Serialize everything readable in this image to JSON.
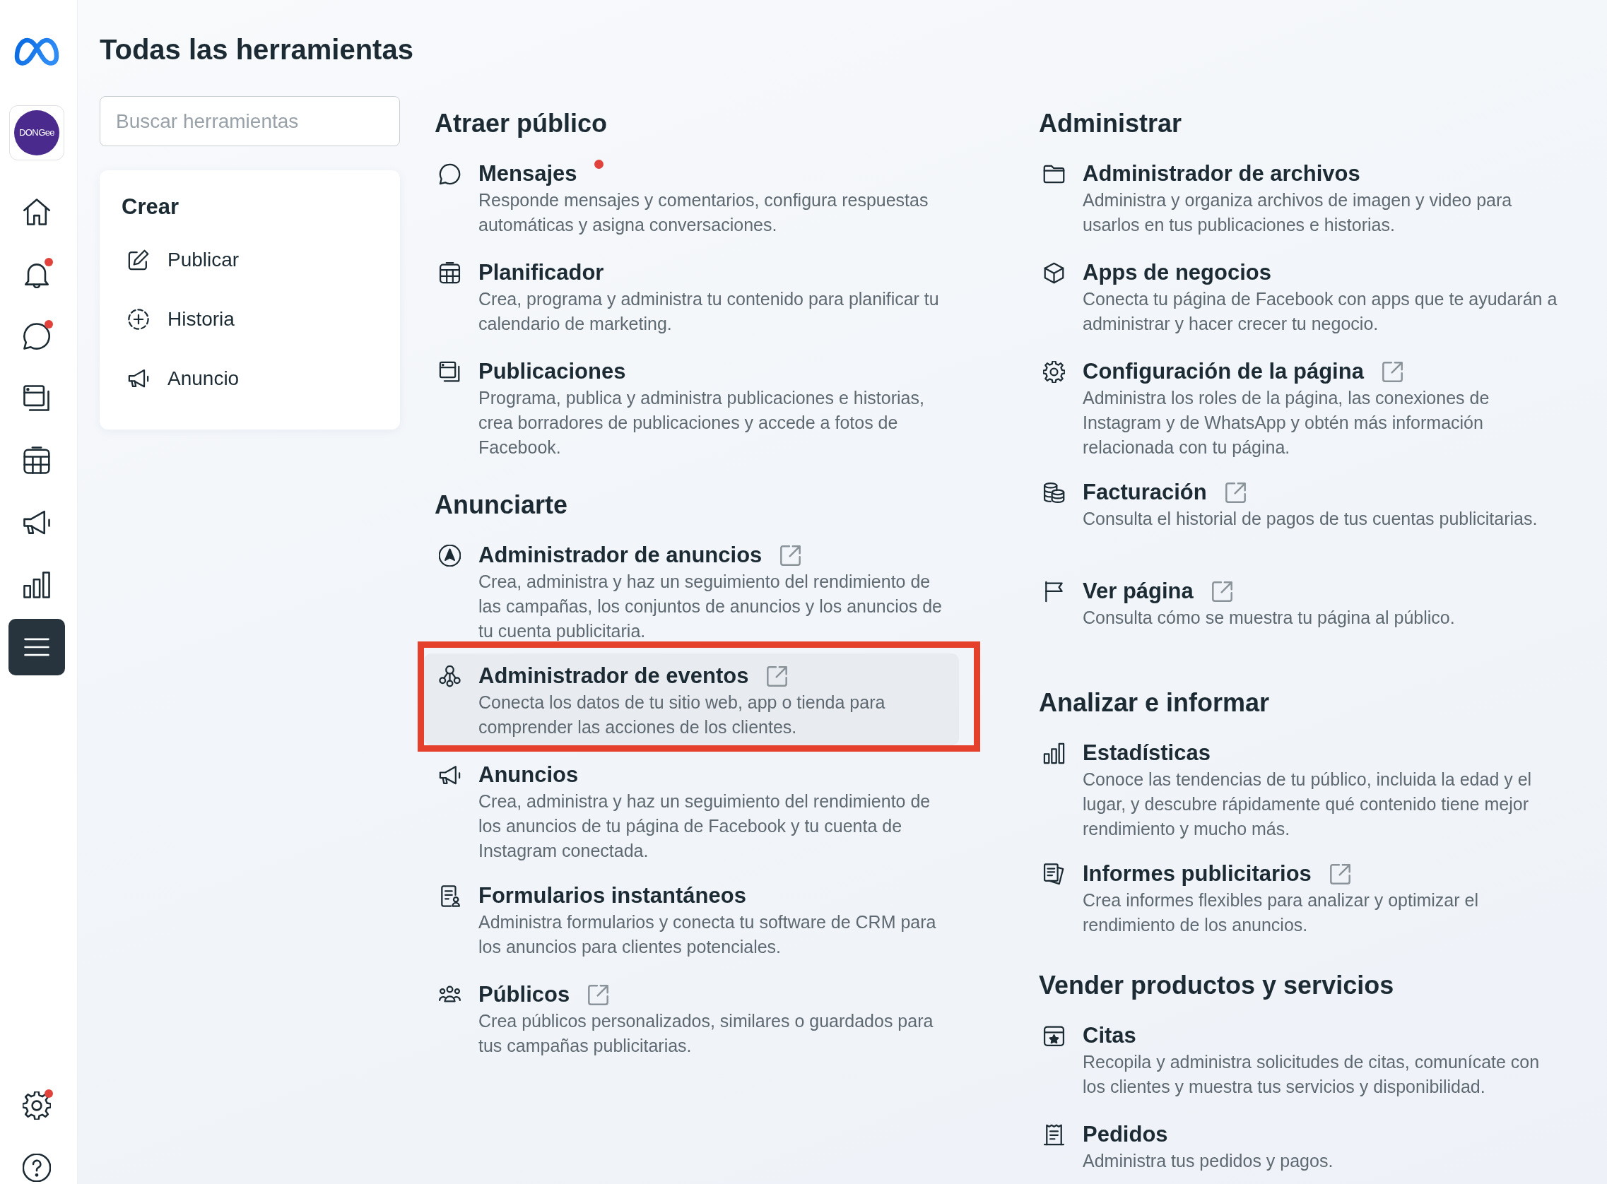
{
  "sidebar": {
    "account": {
      "logo_text": "DONGee"
    },
    "nav": [
      {
        "selected": false,
        "notification": false
      },
      {
        "selected": false,
        "notification": true
      },
      {
        "selected": false,
        "notification": true
      },
      {
        "selected": false,
        "notification": false
      },
      {
        "selected": false,
        "notification": false
      },
      {
        "selected": false,
        "notification": false
      },
      {
        "selected": false,
        "notification": false
      },
      {
        "selected": true,
        "notification": false
      }
    ],
    "footer_nav": [
      {
        "selected": false,
        "notification": true
      },
      {
        "selected": false,
        "notification": false
      }
    ]
  },
  "title": "Todas las herramientas",
  "search": {
    "placeholder": "Buscar herramientas"
  },
  "create_panel": {
    "title": "Crear",
    "items": [
      "Publicar",
      "Historia",
      "Anuncio"
    ]
  },
  "columns": [
    {
      "sections": [
        {
          "heading": "Atraer público",
          "items": [
            {
              "title": "Mensajes",
              "description": "Responde mensajes y comentarios, configura respuestas automáticas y asigna conversaciones.",
              "external_link": false,
              "notification": true,
              "highlighted": false
            },
            {
              "title": "Planificador",
              "description": "Crea, programa y administra tu contenido para planificar tu calendario de marketing.",
              "external_link": false,
              "notification": false,
              "highlighted": false
            },
            {
              "title": "Publicaciones",
              "description": "Programa, publica y administra publicaciones e historias, crea borradores de publicaciones y accede a fotos de Facebook.",
              "external_link": false,
              "notification": false,
              "highlighted": false
            }
          ]
        },
        {
          "heading": "Anunciarte",
          "items": [
            {
              "title": "Administrador de anuncios",
              "description": "Crea, administra y haz un seguimiento del rendimiento de las campañas, los conjuntos de anuncios y los anuncios de tu cuenta publicitaria.",
              "external_link": true,
              "notification": false,
              "highlighted": false
            },
            {
              "title": "Administrador de eventos",
              "description": "Conecta los datos de tu sitio web, app o tienda para comprender las acciones de los clientes.",
              "external_link": true,
              "notification": false,
              "highlighted": true
            },
            {
              "title": "Anuncios",
              "description": "Crea, administra y haz un seguimiento del rendimiento de los anuncios de tu página de Facebook y tu cuenta de Instagram conectada.",
              "external_link": false,
              "notification": false,
              "highlighted": false
            },
            {
              "title": "Formularios instantáneos",
              "description": "Administra formularios y conecta tu software de CRM para los anuncios para clientes potenciales.",
              "external_link": false,
              "notification": false,
              "highlighted": false
            },
            {
              "title": "Públicos",
              "description": "Crea públicos personalizados, similares o guardados para tus campañas publicitarias.",
              "external_link": true,
              "notification": false,
              "highlighted": false
            }
          ]
        }
      ]
    },
    {
      "sections": [
        {
          "heading": "Administrar",
          "items": [
            {
              "title": "Administrador de archivos",
              "description": "Administra y organiza archivos de imagen y video para usarlos en tus publicaciones e historias.",
              "external_link": false,
              "notification": false,
              "highlighted": false
            },
            {
              "title": "Apps de negocios",
              "description": "Conecta tu página de Facebook con apps que te ayudarán a administrar y hacer crecer tu negocio.",
              "external_link": false,
              "notification": false,
              "highlighted": false
            },
            {
              "title": "Configuración de la página",
              "description": "Administra los roles de la página, las conexiones de Instagram y de WhatsApp y obtén más información relacionada con tu página.",
              "external_link": true,
              "notification": false,
              "highlighted": false
            },
            {
              "title": "Facturación",
              "description": "Consulta el historial de pagos de tus cuentas publicitarias.",
              "external_link": true,
              "notification": false,
              "highlighted": false
            },
            {
              "title": "Ver página",
              "description": "Consulta cómo se muestra tu página al público.",
              "external_link": true,
              "notification": false,
              "highlighted": false
            }
          ]
        },
        {
          "heading": "Analizar e informar",
          "items": [
            {
              "title": "Estadísticas",
              "description": "Conoce las tendencias de tu público, incluida la edad y el lugar, y descubre rápidamente qué contenido tiene mejor rendimiento y mucho más.",
              "external_link": false,
              "notification": false,
              "highlighted": false
            },
            {
              "title": "Informes publicitarios",
              "description": "Crea informes flexibles para analizar y optimizar el rendimiento de los anuncios.",
              "external_link": true,
              "notification": false,
              "highlighted": false
            }
          ]
        },
        {
          "heading": "Vender productos y servicios",
          "items": [
            {
              "title": "Citas",
              "description": "Recopila y administra solicitudes de citas, comunícate con los clientes y muestra tus servicios y disponibilidad.",
              "external_link": false,
              "notification": false,
              "highlighted": false
            },
            {
              "title": "Pedidos",
              "description": "Administra tus pedidos y pagos.",
              "external_link": false,
              "notification": false,
              "highlighted": false
            }
          ]
        }
      ]
    }
  ]
}
